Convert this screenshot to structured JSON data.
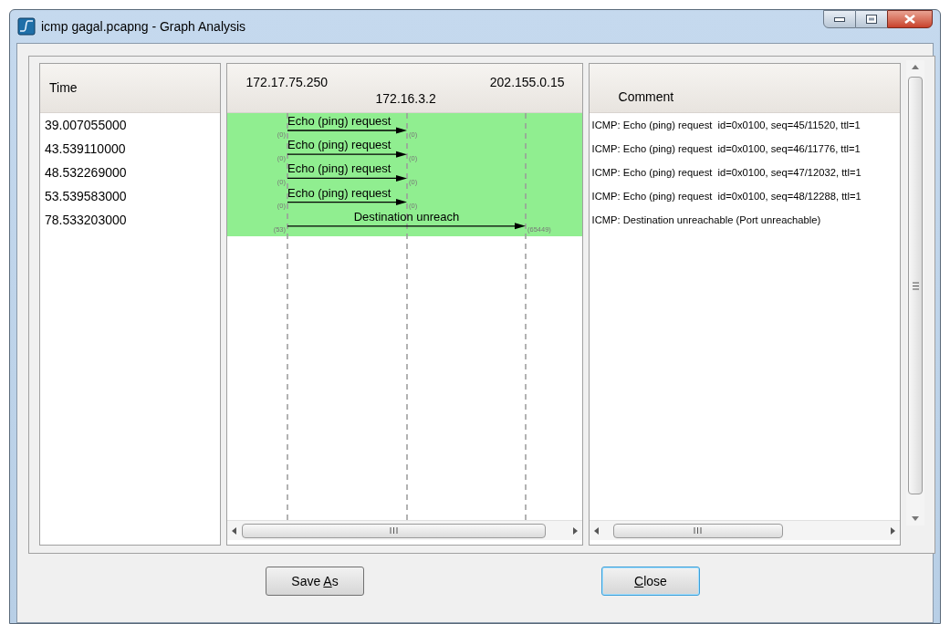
{
  "window": {
    "title": "icmp gagal.pcapng - Graph Analysis"
  },
  "time_column": {
    "header": "Time"
  },
  "graph": {
    "nodes": [
      "172.17.75.250",
      "172.16.3.2",
      "202.155.0.15"
    ]
  },
  "comment_column": {
    "header": "Comment"
  },
  "rows": [
    {
      "time": "39.007055000",
      "message": "Echo (ping) request",
      "kind": "near",
      "from_port": "(0)",
      "to_port": "(0)",
      "comment": "ICMP: Echo (ping) request  id=0x0100, seq=45/11520, ttl=1"
    },
    {
      "time": "43.539110000",
      "message": "Echo (ping) request",
      "kind": "near",
      "from_port": "(0)",
      "to_port": "(0)",
      "comment": "ICMP: Echo (ping) request  id=0x0100, seq=46/11776, ttl=1"
    },
    {
      "time": "48.532269000",
      "message": "Echo (ping) request",
      "kind": "near",
      "from_port": "(0)",
      "to_port": "(0)",
      "comment": "ICMP: Echo (ping) request  id=0x0100, seq=47/12032, ttl=1"
    },
    {
      "time": "53.539583000",
      "message": "Echo (ping) request",
      "kind": "near",
      "from_port": "(0)",
      "to_port": "(0)",
      "comment": "ICMP: Echo (ping) request  id=0x0100, seq=48/12288, ttl=1"
    },
    {
      "time": "78.533203000",
      "message": "Destination unreach",
      "kind": "far",
      "from_port": "(53)",
      "to_port": "(65449)",
      "comment": "ICMP: Destination unreachable (Port unreachable)"
    }
  ],
  "buttons": [
    {
      "before": "Save ",
      "access_key": "A",
      "after": "s",
      "default": false
    },
    {
      "access_key": "C",
      "after": "lose",
      "default": true
    }
  ]
}
